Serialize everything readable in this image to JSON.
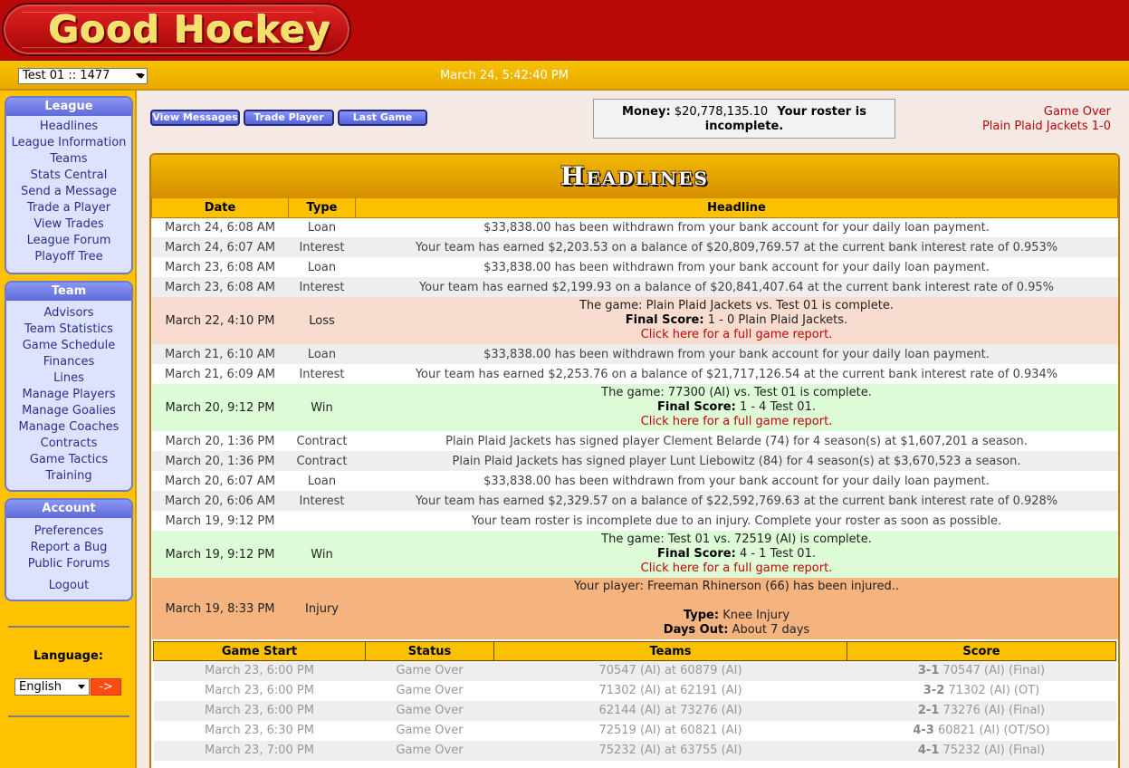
{
  "header": {
    "logo_text": "Good Hockey",
    "team_select": "Test 01 :: 1477",
    "clock": "March 24, 5:42:40 PM"
  },
  "sidebar": {
    "league": {
      "title": "League",
      "items": [
        "Headlines",
        "League Information",
        "Teams",
        "Stats Central",
        "Send a Message",
        "Trade a Player",
        "View Trades",
        "League Forum",
        "Playoff Tree"
      ]
    },
    "team": {
      "title": "Team",
      "items": [
        "Advisors",
        "Team Statistics",
        "Game Schedule",
        "Finances",
        "Lines",
        "Manage Players",
        "Manage Goalies",
        "Manage Coaches",
        "Contracts",
        "Game Tactics",
        "Training"
      ]
    },
    "account": {
      "title": "Account",
      "items": [
        "Preferences",
        "Report a Bug",
        "Public Forums",
        "Logout"
      ]
    },
    "language_label": "Language:",
    "language_value": "English",
    "language_go": "->"
  },
  "toolbar": {
    "view_messages": "View Messages",
    "trade_player": "Trade Player",
    "last_game": "Last Game"
  },
  "status": {
    "money_label": "Money:",
    "money_value": "$20,778,135.10",
    "roster_note": "Your roster is incomplete.",
    "last_game_line1": "Game Over",
    "last_game_line2": "Plain Plaid Jackets 1-0"
  },
  "headlines": {
    "title": "Headlines",
    "columns": [
      "Date",
      "Type",
      "Headline"
    ],
    "rows": [
      {
        "date": "March 24, 6:08 AM",
        "type": "Loan",
        "text": "$33,838.00 has been withdrawn from your bank account for your daily loan payment."
      },
      {
        "date": "March 24, 6:07 AM",
        "type": "Interest",
        "text": "Your team has earned $2,203.53 on a balance of $20,809,769.57 at the current bank interest rate of 0.953%"
      },
      {
        "date": "March 23, 6:08 AM",
        "type": "Loan",
        "text": "$33,838.00 has been withdrawn from your bank account for your daily loan payment."
      },
      {
        "date": "March 23, 6:08 AM",
        "type": "Interest",
        "text": "Your team has earned $2,199.93 on a balance of $20,841,407.64 at the current bank interest rate of 0.95%"
      },
      {
        "date": "March 22, 4:10 PM",
        "type": "Loss",
        "game": "The game: Plain Plaid Jackets vs. Test 01 is complete.",
        "score_label": "Final Score:",
        "score": "1 - 0 Plain Plaid Jackets.",
        "link": "Click here for a full game report."
      },
      {
        "date": "March 21, 6:10 AM",
        "type": "Loan",
        "text": "$33,838.00 has been withdrawn from your bank account for your daily loan payment."
      },
      {
        "date": "March 21, 6:09 AM",
        "type": "Interest",
        "text": "Your team has earned $2,253.76 on a balance of $21,717,126.54 at the current bank interest rate of 0.934%"
      },
      {
        "date": "March 20, 9:12 PM",
        "type": "Win",
        "game": "The game: 77300 (AI) vs. Test 01 is complete.",
        "score_label": "Final Score:",
        "score": "1 - 4 Test 01.",
        "link": "Click here for a full game report."
      },
      {
        "date": "March 20, 1:36 PM",
        "type": "Contract",
        "text": "Plain Plaid Jackets has signed player Clement Belarde (74) for 4 season(s) at $1,607,201 a season."
      },
      {
        "date": "March 20, 1:36 PM",
        "type": "Contract",
        "text": "Plain Plaid Jackets has signed player Lunt Liebowitz (84) for 4 season(s) at $3,670,523 a season."
      },
      {
        "date": "March 20, 6:07 AM",
        "type": "Loan",
        "text": "$33,838.00 has been withdrawn from your bank account for your daily loan payment."
      },
      {
        "date": "March 20, 6:06 AM",
        "type": "Interest",
        "text": "Your team has earned $2,329.57 on a balance of $22,592,769.63 at the current bank interest rate of 0.928%"
      },
      {
        "date": "March 19, 9:12 PM",
        "type": "",
        "text": "Your team roster is incomplete due to an injury. Complete your roster as soon as possible."
      },
      {
        "date": "March 19, 9:12 PM",
        "type": "Win",
        "game": "The game: Test 01 vs. 72519 (AI) is complete.",
        "score_label": "Final Score:",
        "score": "4 - 1 Test 01.",
        "link": "Click here for a full game report."
      },
      {
        "date": "March 19, 8:33 PM",
        "type": "Injury",
        "injury": "Your player: Freeman Rhinerson (66) has been injured..",
        "type_label": "Type:",
        "type_value": "Knee Injury",
        "days_label": "Days Out:",
        "days_value": "About 7 days"
      }
    ]
  },
  "games": {
    "columns": [
      "Game Start",
      "Status",
      "Teams",
      "Score"
    ],
    "rows": [
      {
        "start": "March 23, 6:00 PM",
        "status": "Game Over",
        "teams": "70547 (AI) at 60879 (AI)",
        "score": "3-1",
        "winner": "70547 (AI) (Final)"
      },
      {
        "start": "March 23, 6:00 PM",
        "status": "Game Over",
        "teams": "71302 (AI) at 62191 (AI)",
        "score": "3-2",
        "winner": "71302 (AI) (OT)"
      },
      {
        "start": "March 23, 6:00 PM",
        "status": "Game Over",
        "teams": "62144 (AI) at 73276 (AI)",
        "score": "2-1",
        "winner": "73276 (AI) (Final)"
      },
      {
        "start": "March 23, 6:30 PM",
        "status": "Game Over",
        "teams": "72519 (AI) at 60821 (AI)",
        "score": "4-3",
        "winner": "60821 (AI) (OT/SO)"
      },
      {
        "start": "March 23, 7:00 PM",
        "status": "Game Over",
        "teams": "75232 (AI) at 63755 (AI)",
        "score": "4-1",
        "winner": "75232 (AI) (Final)"
      }
    ]
  }
}
